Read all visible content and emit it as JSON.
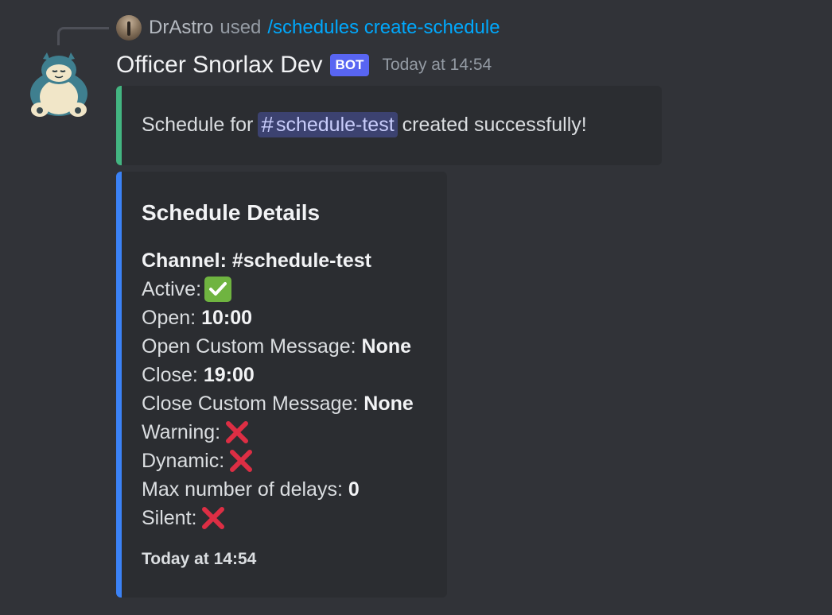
{
  "reply": {
    "username": "DrAstro",
    "used_text": "used",
    "command": "/schedules create-schedule"
  },
  "message": {
    "author": "Officer Snorlax Dev",
    "bot_tag": "BOT",
    "timestamp": "Today at 14:54"
  },
  "embed_success": {
    "prefix": "Schedule for",
    "channel_mention": "schedule-test",
    "suffix": "created successfully!",
    "accent_color": "#43b581"
  },
  "embed_details": {
    "title": "Schedule Details",
    "channel_label": "Channel: #schedule-test",
    "active_label": "Active:",
    "open_label": "Open:",
    "open_value": "10:00",
    "open_msg_label": "Open Custom Message:",
    "open_msg_value": "None",
    "close_label": "Close:",
    "close_value": "19:00",
    "close_msg_label": "Close Custom Message:",
    "close_msg_value": "None",
    "warning_label": "Warning:",
    "dynamic_label": "Dynamic:",
    "delays_label": "Max number of delays:",
    "delays_value": "0",
    "silent_label": "Silent:",
    "footer": "Today at 14:54",
    "accent_color": "#3b82f6",
    "true_icon": "check-mark-icon",
    "false_icon": "cross-mark-icon"
  }
}
